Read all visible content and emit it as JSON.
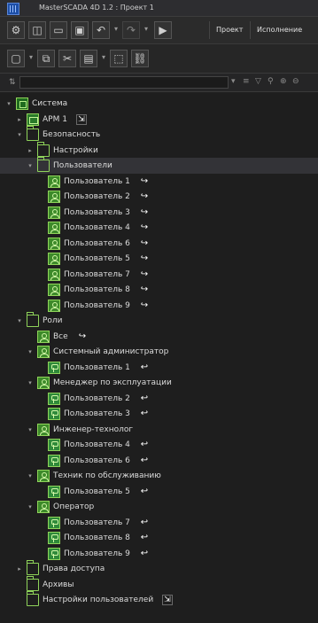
{
  "window": {
    "title": "MasterSCADA 4D 1.2 : Проект 1"
  },
  "toolbar": {
    "tabs": [
      {
        "label": "Проект"
      },
      {
        "label": "Исполнение"
      }
    ]
  },
  "filter": {
    "value": "",
    "placeholder": ""
  },
  "tree": [
    {
      "id": "sistema",
      "label": "Система",
      "level": 0,
      "icon": "system-icon",
      "expander": "down",
      "link": ""
    },
    {
      "id": "arm1",
      "label": "АРМ 1",
      "level": 1,
      "icon": "workstation-icon",
      "expander": "right",
      "link": "attach"
    },
    {
      "id": "bezopasnost",
      "label": "Безопасность",
      "level": 1,
      "icon": "folder-icon",
      "expander": "down",
      "link": ""
    },
    {
      "id": "nastroiki",
      "label": "Настройки",
      "level": 2,
      "icon": "folder-icon",
      "expander": "right",
      "link": ""
    },
    {
      "id": "polzovateli",
      "label": "Пользователи",
      "level": 2,
      "icon": "folder-icon",
      "expander": "down",
      "link": "",
      "selected": true
    },
    {
      "id": "p1",
      "label": "Пользователь 1",
      "level": 3,
      "icon": "user-icon",
      "expander": "",
      "link": "forward"
    },
    {
      "id": "p2",
      "label": "Пользователь 2",
      "level": 3,
      "icon": "user-icon",
      "expander": "",
      "link": "forward"
    },
    {
      "id": "p3",
      "label": "Пользователь 3",
      "level": 3,
      "icon": "user-icon",
      "expander": "",
      "link": "forward"
    },
    {
      "id": "p4",
      "label": "Пользователь 4",
      "level": 3,
      "icon": "user-icon",
      "expander": "",
      "link": "forward"
    },
    {
      "id": "p5",
      "label": "Пользователь 6",
      "level": 3,
      "icon": "user-icon",
      "expander": "",
      "link": "forward"
    },
    {
      "id": "p6",
      "label": "Пользователь 5",
      "level": 3,
      "icon": "user-icon",
      "expander": "",
      "link": "forward"
    },
    {
      "id": "p7",
      "label": "Пользователь 7",
      "level": 3,
      "icon": "user-icon",
      "expander": "",
      "link": "forward"
    },
    {
      "id": "p8",
      "label": "Пользователь 8",
      "level": 3,
      "icon": "user-icon",
      "expander": "",
      "link": "forward"
    },
    {
      "id": "p9",
      "label": "Пользователь 9",
      "level": 3,
      "icon": "user-icon",
      "expander": "",
      "link": "forward"
    },
    {
      "id": "roli",
      "label": "Роли",
      "level": 1,
      "icon": "folder-icon",
      "expander": "down",
      "link": ""
    },
    {
      "id": "vse",
      "label": "Все",
      "level": 2,
      "icon": "role-icon",
      "expander": "",
      "link": "forward"
    },
    {
      "id": "sysadm",
      "label": "Системный администратор",
      "level": 2,
      "icon": "role-icon",
      "expander": "down",
      "link": ""
    },
    {
      "id": "sa_p1",
      "label": "Пользователь 1",
      "level": 3,
      "icon": "role-user-icon",
      "expander": "",
      "link": "back"
    },
    {
      "id": "manager",
      "label": "Менеджер по эксплуатации",
      "level": 2,
      "icon": "role-icon",
      "expander": "down",
      "link": ""
    },
    {
      "id": "m_p2",
      "label": "Пользователь 2",
      "level": 3,
      "icon": "role-user-icon",
      "expander": "",
      "link": "back"
    },
    {
      "id": "m_p3",
      "label": "Пользователь 3",
      "level": 3,
      "icon": "role-user-icon",
      "expander": "",
      "link": "back"
    },
    {
      "id": "engineer",
      "label": "Инженер-технолог",
      "level": 2,
      "icon": "role-icon",
      "expander": "down",
      "link": ""
    },
    {
      "id": "e_p4",
      "label": "Пользователь 4",
      "level": 3,
      "icon": "role-user-icon",
      "expander": "",
      "link": "back"
    },
    {
      "id": "e_p6",
      "label": "Пользователь 6",
      "level": 3,
      "icon": "role-user-icon",
      "expander": "",
      "link": "back"
    },
    {
      "id": "tech",
      "label": "Техник по обслуживанию",
      "level": 2,
      "icon": "role-icon",
      "expander": "down",
      "link": ""
    },
    {
      "id": "t_p5",
      "label": "Пользователь 5",
      "level": 3,
      "icon": "role-user-icon",
      "expander": "",
      "link": "back"
    },
    {
      "id": "operator",
      "label": "Оператор",
      "level": 2,
      "icon": "role-icon",
      "expander": "down",
      "link": ""
    },
    {
      "id": "o_p7",
      "label": "Пользователь 7",
      "level": 3,
      "icon": "role-user-icon",
      "expander": "",
      "link": "back"
    },
    {
      "id": "o_p8",
      "label": "Пользователь 8",
      "level": 3,
      "icon": "role-user-icon",
      "expander": "",
      "link": "back"
    },
    {
      "id": "o_p9",
      "label": "Пользователь 9",
      "level": 3,
      "icon": "role-user-icon",
      "expander": "",
      "link": "back"
    },
    {
      "id": "prava",
      "label": "Права доступа",
      "level": 1,
      "icon": "folder-icon",
      "expander": "right",
      "link": ""
    },
    {
      "id": "arhivy",
      "label": "Архивы",
      "level": 1,
      "icon": "folder-icon",
      "expander": "",
      "link": ""
    },
    {
      "id": "nastroiki_polz",
      "label": "Настройки пользователей",
      "level": 1,
      "icon": "folder-icon",
      "expander": "",
      "link": "attach"
    }
  ]
}
